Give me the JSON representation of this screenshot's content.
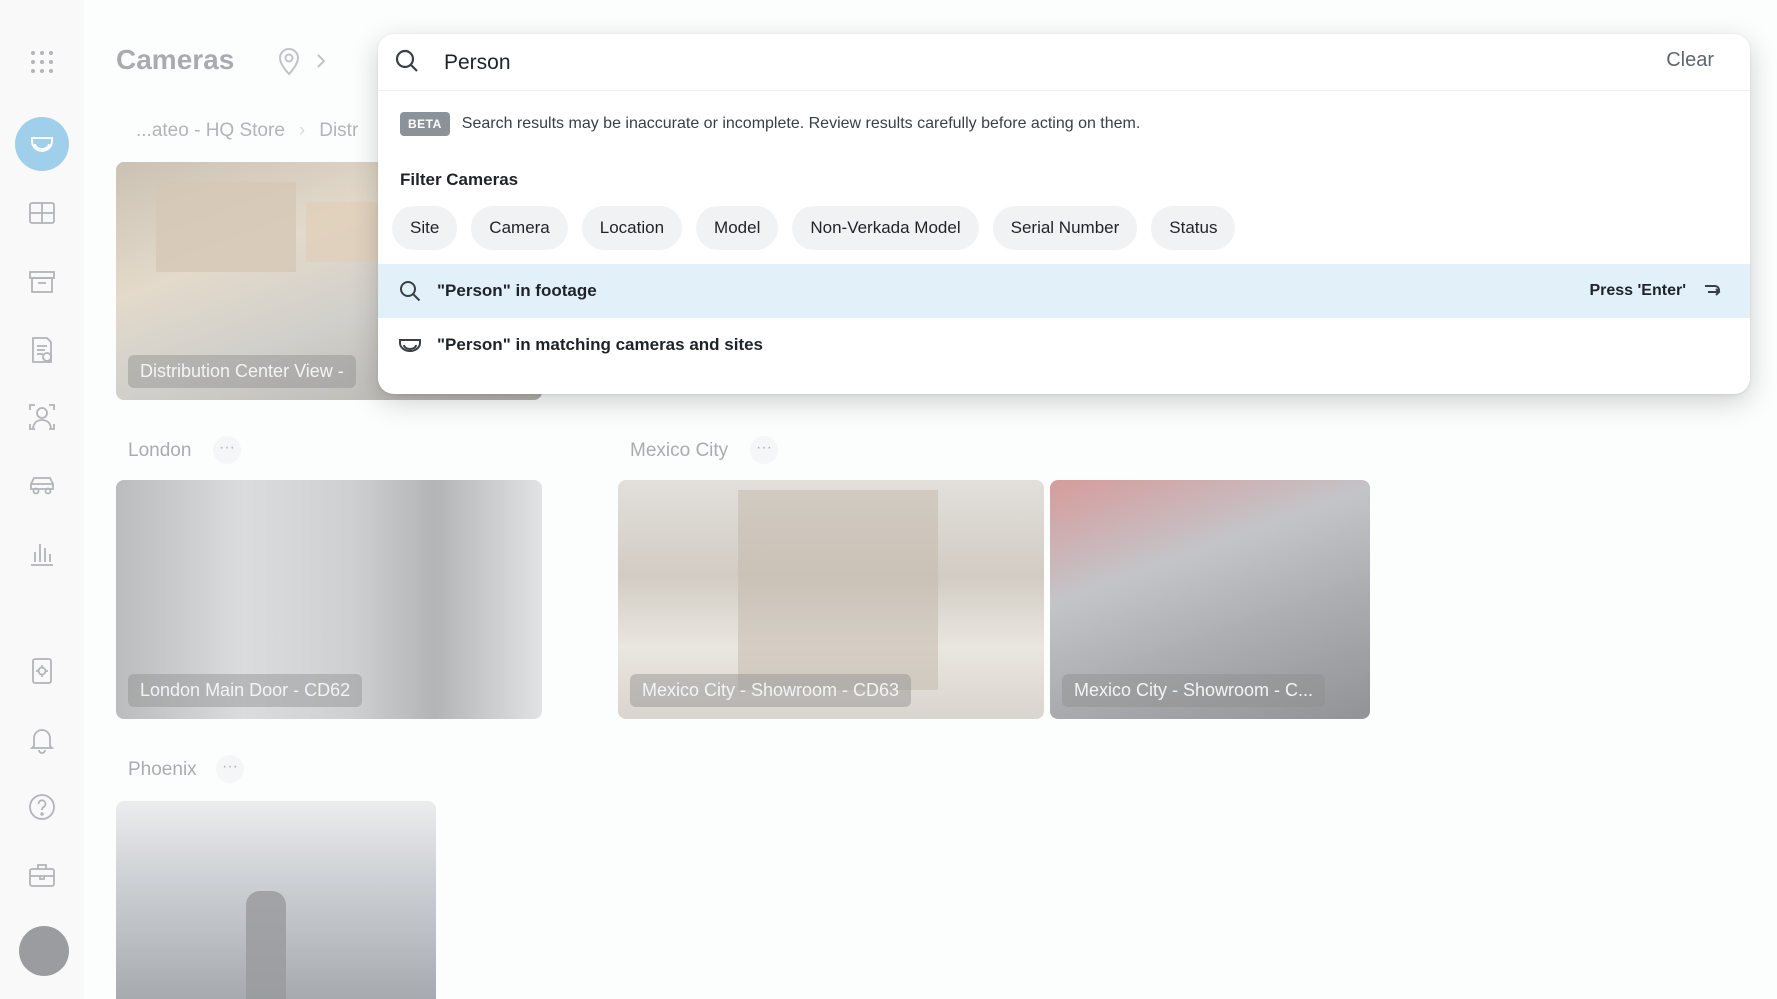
{
  "app": {
    "page_title": "Cameras",
    "breadcrumbs": [
      "...ateo - HQ Store",
      "Distr"
    ]
  },
  "sidebar": {
    "items": [
      {
        "icon": "apps-grid-icon"
      },
      {
        "icon": "camera-dome-icon",
        "active": true
      },
      {
        "icon": "grid-layout-icon"
      },
      {
        "icon": "archive-box-icon"
      },
      {
        "icon": "report-document-icon"
      },
      {
        "icon": "person-detect-icon"
      },
      {
        "icon": "vehicle-icon"
      },
      {
        "icon": "analytics-chart-icon"
      },
      {
        "icon": "device-settings-icon"
      },
      {
        "icon": "bell-icon"
      },
      {
        "icon": "help-icon"
      },
      {
        "icon": "toolbox-icon"
      },
      {
        "icon": "avatar"
      }
    ]
  },
  "camera_groups": [
    {
      "name": "",
      "cameras": [
        {
          "label": "Distribution Center View -"
        }
      ]
    },
    {
      "name": "London",
      "more": "···",
      "cameras": [
        {
          "label": "London Main Door - CD62"
        }
      ]
    },
    {
      "name": "Mexico City",
      "more": "···",
      "cameras": [
        {
          "label": "Mexico City - Showroom - CD63"
        },
        {
          "label": "Mexico City - Showroom - C..."
        }
      ]
    },
    {
      "name": "Phoenix",
      "more": "···",
      "cameras": [
        {
          "label": ""
        }
      ]
    }
  ],
  "search": {
    "value": "Person",
    "clear_label": "Clear",
    "beta_badge": "BETA",
    "beta_notice": "Search results may be inaccurate or incomplete. Review results carefully before acting on them.",
    "filter_title": "Filter Cameras",
    "filters": [
      "Site",
      "Camera",
      "Location",
      "Model",
      "Non-Verkada Model",
      "Serial Number",
      "Status"
    ],
    "results": [
      {
        "text": "\"Person\" in footage",
        "hint": "Press 'Enter'",
        "icon": "search-icon"
      },
      {
        "text": "\"Person\" in matching cameras and sites",
        "icon": "camera-dome-icon"
      }
    ]
  },
  "colors": {
    "accent": "#4aa3d9",
    "highlight_row": "#e2f1f9"
  }
}
